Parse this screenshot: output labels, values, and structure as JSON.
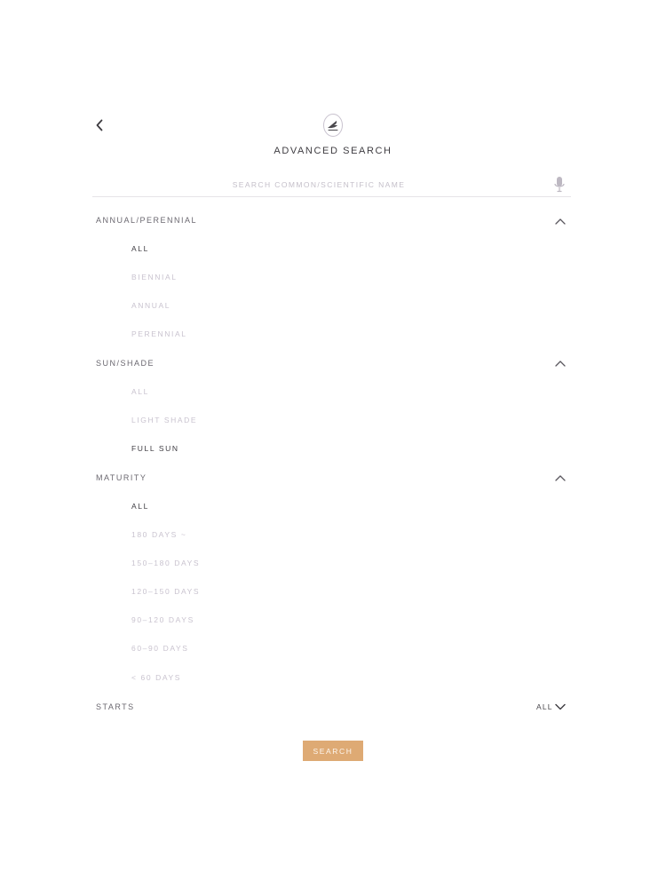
{
  "header": {
    "title": "ADVANCED SEARCH",
    "back_icon": "chevron-left-icon",
    "logo_icon": "bird-logo-icon"
  },
  "search": {
    "placeholder": "SEARCH COMMON/SCIENTIFIC NAME",
    "value": "",
    "mic_icon": "microphone-icon"
  },
  "sections": {
    "annual_perennial": {
      "label": "ANNUAL/PERENNIAL",
      "expanded": true,
      "options": [
        "ALL",
        "BIENNIAL",
        "ANNUAL",
        "PERENNIAL"
      ],
      "selected": "ALL"
    },
    "sun_shade": {
      "label": "SUN/SHADE",
      "expanded": true,
      "options": [
        "ALL",
        "LIGHT SHADE",
        "FULL SUN"
      ],
      "selected": "FULL SUN"
    },
    "maturity": {
      "label": "MATURITY",
      "expanded": true,
      "options": [
        "ALL",
        "180 DAYS ~",
        "150–180 DAYS",
        "120–150 DAYS",
        "90–120 DAYS",
        "60–90 DAYS",
        "< 60 DAYS"
      ],
      "selected": "ALL"
    },
    "starts": {
      "label": "STARTS",
      "expanded": false,
      "value": "ALL"
    }
  },
  "search_button": {
    "label": "SEARCH"
  },
  "colors": {
    "accent": "#deaa74",
    "text_selected": "#3e3c42",
    "text_unselected": "#c9c3cf",
    "divider": "#e6e4e8"
  }
}
